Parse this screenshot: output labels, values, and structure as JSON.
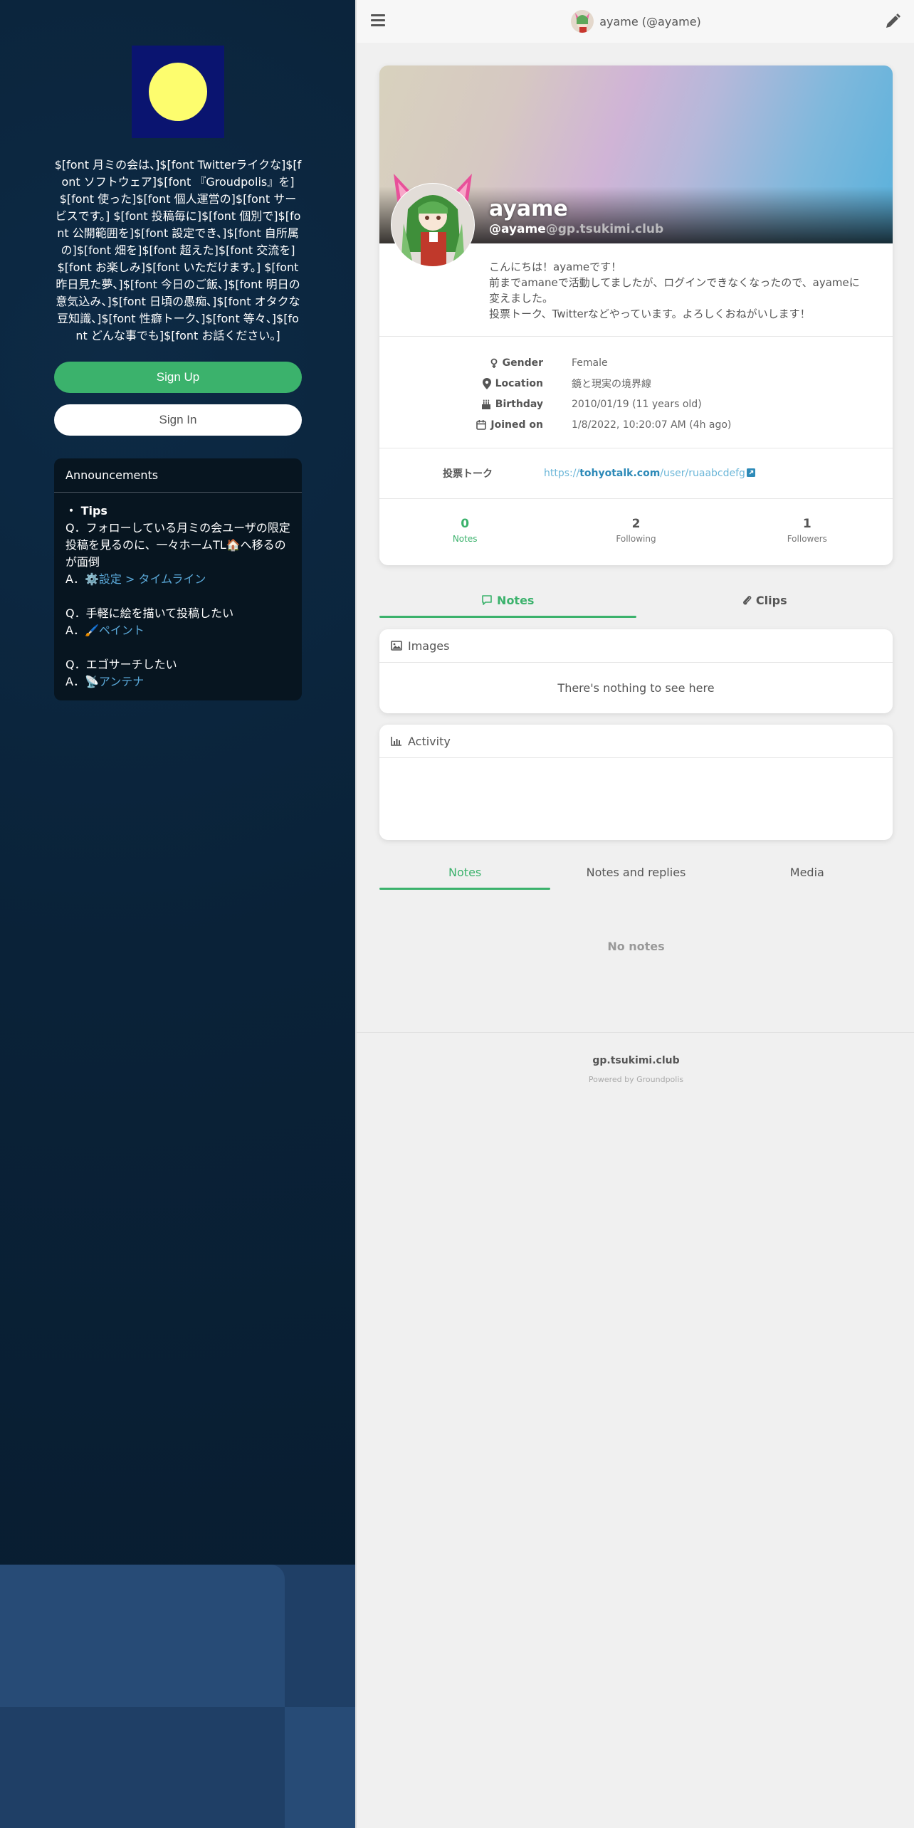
{
  "left": {
    "description": "$[font 月ミの会は、]$[font Twitterライクな]$[font ソフトウェア]$[font 『Groudpolis』を]$[font 使った]$[font 個人運営の]$[font サービスです。] $[font 投稿毎に]$[font 個別で]$[font 公開範囲を]$[font 設定でき、]$[font 自所属の]$[font 畑を]$[font 超えた]$[font 交流を]$[font お楽しみ]$[font いただけます。] $[font 昨日見た夢、]$[font 今日のご飯、]$[font 明日の意気込み、]$[font 日頃の愚痴、]$[font オタクな豆知識、]$[font 性癖トーク、]$[font 等々、]$[font どんな事でも]$[font お話ください。]",
    "signup_label": "Sign Up",
    "signin_label": "Sign In",
    "announcements": {
      "title": "Announcements",
      "tips_title": "・ Tips",
      "q1": "Q．フォローしている月ミの会ユーザの限定投稿を見るのに、一々ホームTL",
      "q1_icon": "🏠",
      "q1_tail": "へ移るのが面倒",
      "a1_prefix": "A．",
      "a1_icon": "⚙️",
      "a1_link": "設定 > タイムライン",
      "q2": "Q．手軽に絵を描いて投稿したい",
      "a2_prefix": "A．",
      "a2_icon": "🖌️",
      "a2_link": "ペイント",
      "q3": "Q．エゴサーチしたい",
      "a3_prefix": "A．",
      "a3_icon": "📡",
      "a3_link": "アンテナ"
    }
  },
  "topbar": {
    "title": "ayame (@ayame)"
  },
  "profile": {
    "name": "ayame",
    "username": "@ayame",
    "host": "@gp.tsukimi.club",
    "bio": [
      "こんにちは！ayameです！",
      "前までamaneで活動してましたが、ログインできなくなったので、ayameに変えました。",
      "投票トーク、Twitterなどやっています。よろしくおねがいします！"
    ],
    "fields": [
      {
        "key": "Gender",
        "value": "Female",
        "icon": "gender-icon"
      },
      {
        "key": "Location",
        "value": "鏡と現実の境界線",
        "icon": "location-icon"
      },
      {
        "key": "Birthday",
        "value": "2010/01/19 (11 years old)",
        "icon": "birthday-cake-icon"
      },
      {
        "key": "Joined on",
        "value": "1/8/2022, 10:20:07 AM (4h ago)",
        "icon": "calendar-icon"
      }
    ],
    "extra_field": {
      "key": "投票トーク",
      "url_scheme": "https://",
      "url_host": "tohyotalk.com",
      "url_path": "/user/ruaabcdefg"
    },
    "stats": [
      {
        "count": "0",
        "label": "Notes"
      },
      {
        "count": "2",
        "label": "Following"
      },
      {
        "count": "1",
        "label": "Followers"
      }
    ]
  },
  "tabs1": [
    {
      "label": "Notes",
      "icon": "comment-icon"
    },
    {
      "label": "Clips",
      "icon": "paperclip-icon"
    }
  ],
  "images_widget": {
    "title": "Images",
    "empty": "There's nothing to see here"
  },
  "activity_widget": {
    "title": "Activity"
  },
  "tabs2": [
    {
      "label": "Notes"
    },
    {
      "label": "Notes and replies"
    },
    {
      "label": "Media"
    }
  ],
  "no_notes": "No notes",
  "footer": {
    "host": "gp.tsukimi.club",
    "powered": "Powered by Groundpolis"
  },
  "colors": {
    "accent": "#3bb26c",
    "link": "#2d8ab8",
    "left_bg": "#0a2238",
    "logo_bg": "#0a1470",
    "logo_moon": "#fdfd6e"
  }
}
